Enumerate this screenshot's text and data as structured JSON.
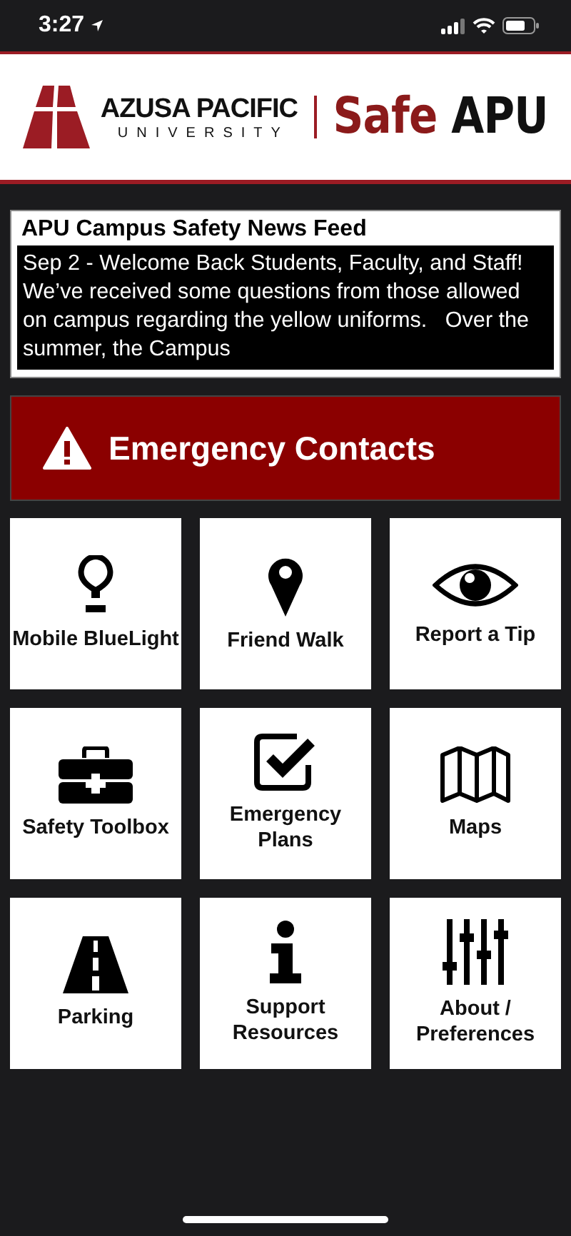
{
  "status_bar": {
    "time": "3:27"
  },
  "header": {
    "university": "AZUSA PACIFIC",
    "university_sub": "UNIVERSITY",
    "app_name_accent": "Safe",
    "app_name": "APU"
  },
  "news_feed": {
    "title": "APU Campus Safety News Feed",
    "text": "Sep 2 - Welcome Back Students, Faculty, and Staff! We’ve received some questions from those allowed on campus regarding the yellow uniforms.   Over the summer, the Campus"
  },
  "emergency": {
    "label": "Emergency Contacts"
  },
  "tiles": [
    {
      "kind": "bulb",
      "label": "Mobile BlueLight"
    },
    {
      "kind": "pin",
      "label": "Friend Walk"
    },
    {
      "kind": "eye",
      "label": "Report a Tip"
    },
    {
      "kind": "toolbox",
      "label": "Safety Toolbox"
    },
    {
      "kind": "check",
      "label": "Emergency Plans"
    },
    {
      "kind": "map",
      "label": "Maps"
    },
    {
      "kind": "road",
      "label": "Parking"
    },
    {
      "kind": "info",
      "label": "Support Resources"
    },
    {
      "kind": "sliders",
      "label": "About / Preferences"
    }
  ]
}
